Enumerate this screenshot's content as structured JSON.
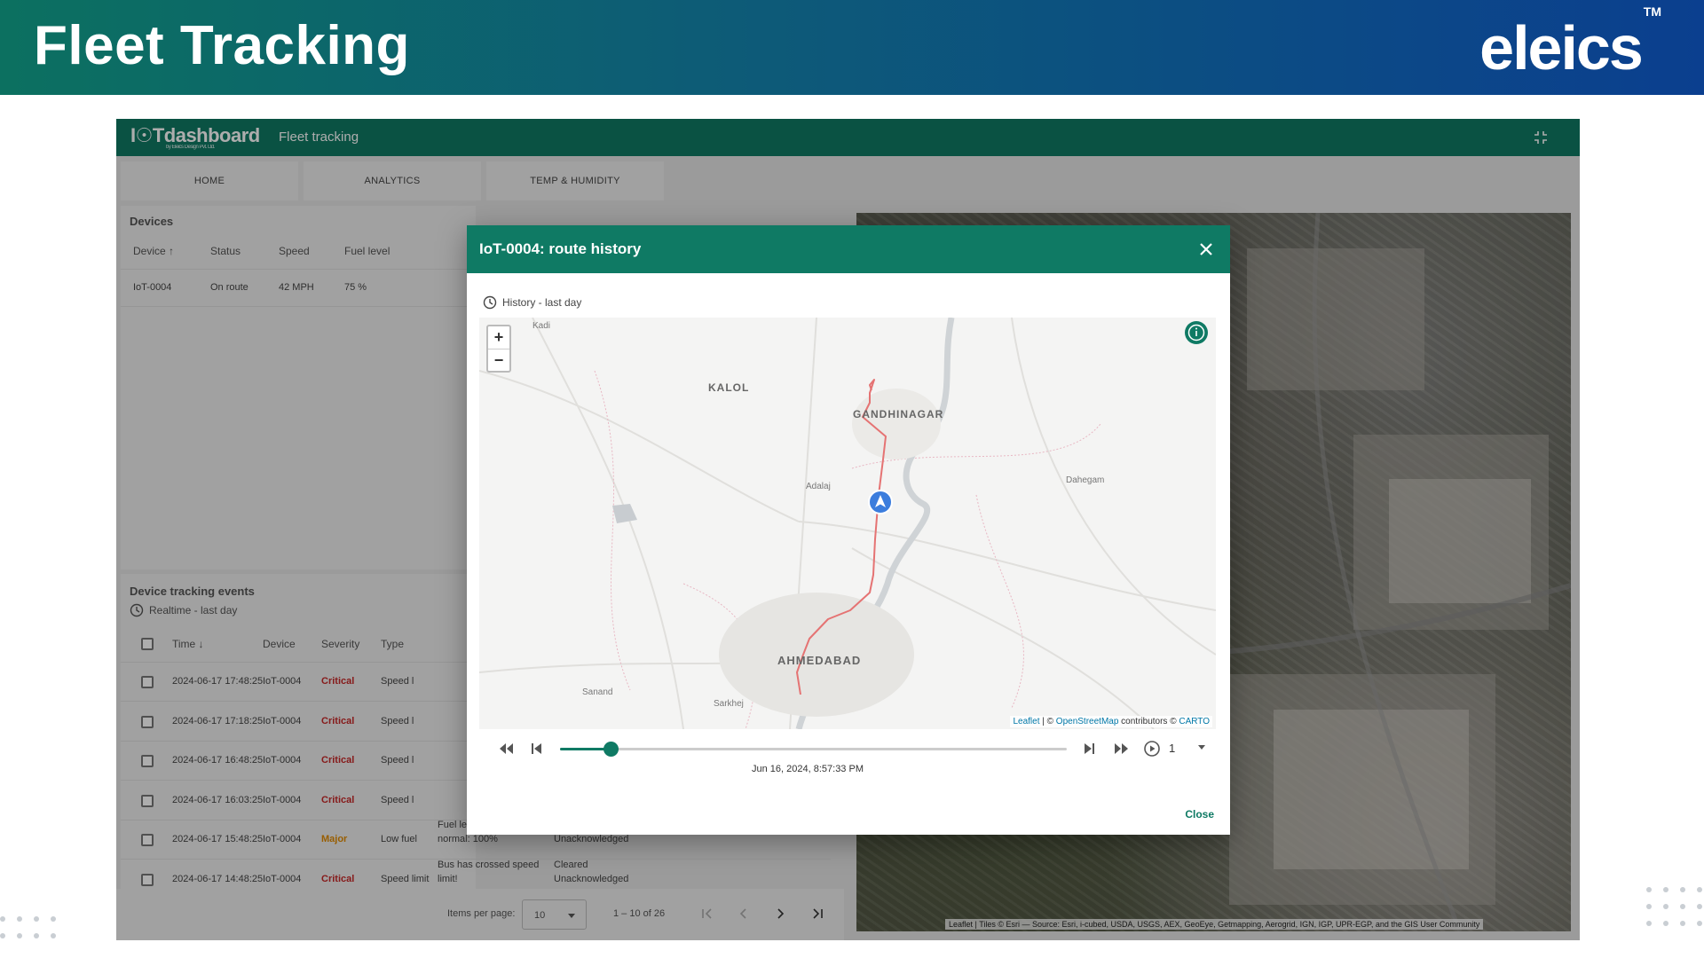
{
  "banner": {
    "title": "Fleet Tracking",
    "brand": "eleics",
    "brand_tm": "TM"
  },
  "app": {
    "logo": "I☉Tdashboard",
    "logo_sub": "by Eleics Design Pvt. Ltd.",
    "title": "Fleet tracking",
    "tabs": [
      "HOME",
      "ANALYTICS",
      "TEMP & HUMIDITY"
    ]
  },
  "devices": {
    "title": "Devices",
    "columns": [
      "Device ↑",
      "Status",
      "Speed",
      "Fuel level"
    ],
    "rows": [
      {
        "device": "IoT-0004",
        "status": "On route",
        "speed": "42 MPH",
        "fuel": "75 %"
      }
    ]
  },
  "events": {
    "title": "Device tracking events",
    "realtime": "Realtime - last day",
    "columns": [
      "Time ↓",
      "Device",
      "Severity",
      "Type"
    ],
    "rows": [
      {
        "time": "2024-06-17 17:48:25",
        "device": "IoT-0004",
        "severity": "Critical",
        "type": "Speed l",
        "details": "",
        "status": ""
      },
      {
        "time": "2024-06-17 17:18:25",
        "device": "IoT-0004",
        "severity": "Critical",
        "type": "Speed l",
        "details": "",
        "status": ""
      },
      {
        "time": "2024-06-17 16:48:25",
        "device": "IoT-0004",
        "severity": "Critical",
        "type": "Speed l",
        "details": "",
        "status": ""
      },
      {
        "time": "2024-06-17 16:03:25",
        "device": "IoT-0004",
        "severity": "Critical",
        "type": "Speed l",
        "details": "",
        "status": ""
      },
      {
        "time": "2024-06-17 15:48:25",
        "device": "IoT-0004",
        "severity": "Major",
        "type": "Low fuel",
        "details": "Fuel level is back to normal: 100%",
        "status": "Cleared Unacknowledged"
      },
      {
        "time": "2024-06-17 14:48:25",
        "device": "IoT-0004",
        "severity": "Critical",
        "type": "Speed limit",
        "details": "Bus has crossed speed limit!",
        "status": "Cleared Unacknowledged"
      }
    ],
    "pager": {
      "items_label": "Items per page:",
      "items_value": "10",
      "range": "1 – 10 of 26"
    }
  },
  "satellite": {
    "attribution": "Leaflet | Tiles © Esri — Source: Esri, i-cubed, USDA, USGS, AEX, GeoEye, Getmapping, Aerogrid, IGN, IGP, UPR-EGP, and the GIS User Community"
  },
  "modal": {
    "title": "IoT-0004: route history",
    "history": "History - last day",
    "cities": {
      "kalol": "KALOL",
      "gandhinagar": "GANDHINAGAR",
      "ahmedabad": "AHMEDABAD"
    },
    "towns": {
      "kadi": "Kadi",
      "adalaj": "Adalaj",
      "dehegam": "Dahegam",
      "sanand": "Sanand",
      "sarkhej": "Sarkhej"
    },
    "attribution": {
      "leaflet": "Leaflet",
      "sep": " | © ",
      "osm": "OpenStreetMap",
      "contrib": " contributors © ",
      "carto": "CARTO"
    },
    "timestamp": "Jun 16, 2024, 8:57:33 PM",
    "speed": "1",
    "progress": 0.1,
    "close": "Close"
  },
  "colors": {
    "brand_green": "#0f7a64",
    "route": "#e57373",
    "marker": "#3b7ddd",
    "critical": "#c62828",
    "major": "#e08a00"
  }
}
